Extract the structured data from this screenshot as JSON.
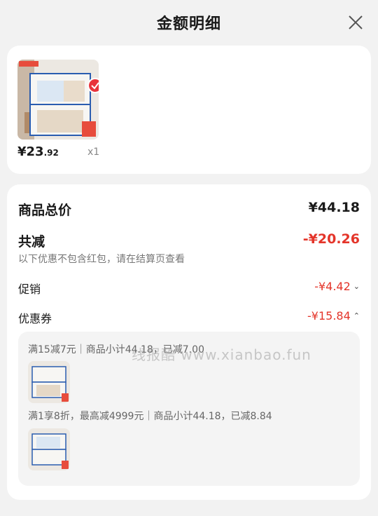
{
  "header": {
    "title": "金额明细"
  },
  "product": {
    "price_main": "¥23",
    "price_cents": ".92",
    "quantity": "x1"
  },
  "summary": {
    "total_label": "商品总价",
    "total_value": "¥44.18",
    "discount_label": "共减",
    "discount_value": "-¥20.26",
    "discount_note": "以下优惠不包含红包，请在结算页查看",
    "promo_label": "促销",
    "promo_value": "-¥4.42",
    "coupon_label": "优惠券",
    "coupon_value": "-¥15.84"
  },
  "coupons": [
    {
      "text": "满15减7元｜商品小计44.18，已减7.00"
    },
    {
      "text": "满1享8折，最高减4999元｜商品小计44.18，已减8.84"
    }
  ],
  "watermark": "线报酷 www.xianbao.fun",
  "colors": {
    "accent_red": "#e4352a",
    "page_bg": "#f2f2f2"
  }
}
